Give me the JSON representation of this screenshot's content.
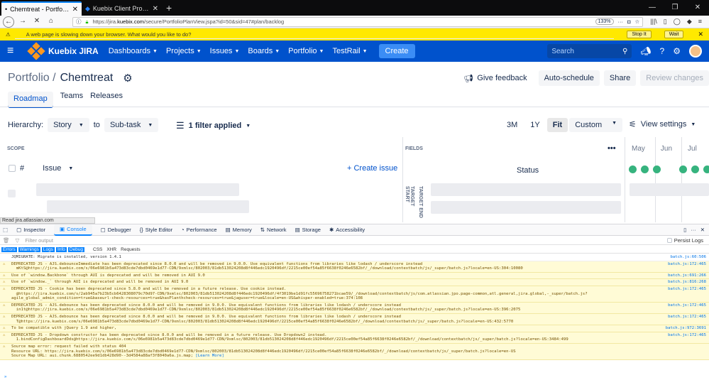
{
  "browser": {
    "tabs": [
      {
        "title": "Chemtreat - Portfolio for Jira",
        "active": true
      },
      {
        "title": "Kuebix Client Projects - Portfolio",
        "active": false
      }
    ],
    "url_prefix": "https://jira.",
    "url_domain": "kuebix.com",
    "url_path": "/secure/PortfolioPlanView.jspa?id=50&sid=47#plan/backlog",
    "zoom": "133%",
    "notification": "A web page is slowing down your browser. What would you like to do?",
    "stop_label": "Stop It",
    "wait_label": "Wait"
  },
  "jira": {
    "brand": "Kuebix JIRA",
    "nav": [
      "Dashboards",
      "Projects",
      "Issues",
      "Boards",
      "Portfolio",
      "TestRail"
    ],
    "create_label": "Create",
    "search_placeholder": "Search"
  },
  "page": {
    "breadcrumb": "Portfolio /",
    "title": "Chemtreat",
    "feedback_label": "Give feedback",
    "autoschedule_label": "Auto-schedule",
    "share_label": "Share",
    "review_label": "Review changes",
    "tabs": [
      "Roadmap",
      "Teams",
      "Releases"
    ],
    "hierarchy_label": "Hierarchy:",
    "hierarchy_from": "Story",
    "hierarchy_to_word": "to",
    "hierarchy_to": "Sub-task",
    "filter_label": "1 filter applied",
    "time_buttons": [
      "3M",
      "1Y",
      "Fit"
    ],
    "custom_label": "Custom",
    "view_settings_label": "View settings",
    "scope_header": "SCOPE",
    "fields_header": "FIELDS",
    "months": [
      "May",
      "Jun",
      "Jul"
    ],
    "hash_col": "#",
    "issue_col": "Issue",
    "create_issue_label": "+ Create issue",
    "status_col": "Status",
    "target_start": "TARGET START",
    "target_end": "TARGET END"
  },
  "statusbar": "Read jira.atlassian.com",
  "devtools": {
    "tabs": [
      "Inspector",
      "Console",
      "Debugger",
      "Style Editor",
      "Performance",
      "Memory",
      "Network",
      "Storage",
      "Accessibility"
    ],
    "filter_placeholder": "Filter output",
    "persist_label": "Persist Logs",
    "levels": [
      "Errors",
      "Warnings",
      "Logs",
      "Info",
      "Debug"
    ],
    "extra_filters": [
      "CSS",
      "XHR",
      "Requests"
    ],
    "messages": [
      {
        "type": "log",
        "text": "JQMIGRATE: Migrate is installed, version 1.4.1",
        "source": "batch.js:60:506"
      },
      {
        "type": "warn",
        "text": "DEPRECATED JS - AJS.debounceImmediate has been deprecated since 8.0.0 and will be removed in 9.0.0. Use equivalent functions from libraries like lodash / underscore instead\n  mKtS@https://jira.kuebix.com/s/06e6981b5a473d83cde7dbd0469e1d77-CDN/9xmlsc/802003/81db513024208d8f446edc1920496df/2215ce00ef54a85f6638f0246e6582bf/_/download/contextbatch/js/_super/batch.js?locale=en-US:304:10080",
        "source": "batch.js:172:465"
      },
      {
        "type": "warn",
        "text": "Use of `window.Backbone` through AUI is deprecated and will be removed in AUI 9.0",
        "source": "batch.js:691:266"
      },
      {
        "type": "warn",
        "text": "Use of `window._` through AUI is deprecated and will be removed in AUI 9.0",
        "source": "batch.js:816:268"
      },
      {
        "type": "warn",
        "text": "DEPRECATED JS - Cookie has been deprecated since 5.8.0 and will be removed in a future release. Use cookie instead.\n  @https://jira.kuebix.com/s/2ab945a7b23b5cb6428308079c70d97-CDN/9xmlsc/802003/81db513024208d8f446edc1920496df/4f3019be1d91fc55696758271bcae59/_/download/contextbatch/js/com.atlassian.jpo.page-common,atl.general,jira.global,-_super/batch.js?agile_global_admin_condition=true&baseurl-check-resources=true&hasPlanthcheck-resources=true&jaguser=true&locale=en-US&whisper-enabled=true:374:108",
        "source": "batch.js:172:465"
      },
      {
        "type": "warn",
        "text": "DEPRECATED JS - AJS.debounce has been deprecated since 8.0.0 and will be removed in 9.0.0. Use equivalent functions from libraries like lodash / underscore instead\n  in1t@https://jira.kuebix.com/s/06e6981b5a473d83cde7dbd0469e1d77-CDN/9xmlsc/802003/81db513024208d8f446edc1920496df/2215ce00ef54a85f6638f0246e6582bf/_/download/contextbatch/js/_super/batch.js?locale=en-US:396:2075",
        "source": "batch.js:172:465"
      },
      {
        "type": "warn",
        "text": "DEPRECATED JS - AJS.debounce has been deprecated since 8.0.0 and will be removed in 9.0.0. Use equivalent functions from libraries like lodash / underscore instead\n  T@https://jira.kuebix.com/s/06e6981b5a473d83cde7dbd0469e1d77-CDN/9xmlsc/802003/81db513024208d8f446edc1920496df/2215ce00ef54a85f6638f0246e6582bf/_/download/contextbatch/js/_super/batch.js?locale=en-US:432:5770",
        "source": "batch.js:172:465"
      },
      {
        "type": "warn",
        "text": "To be compatible with jQuery 1.9 and higher,",
        "source": "batch.js:972:3691"
      },
      {
        "type": "warn",
        "text": "DEPRECATED JS - Dropdown constructor has been deprecated since 8.0.0 and will be removed in a future release. Use Dropdown2 instead.\n  1.bindConfigDashboardDds@https://jira.kuebix.com/s/06e6981b5a473d83cde7dbd0469e1d77-CDN/9xmlsc/802003/81db513024208d8f446edc1920496df/2215ce00ef54a85f6638f0246e6582bf/_/download/contextbatch/js/_super/batch.js?locale=en-US:3484:499",
        "source": "batch.js:172:465"
      },
      {
        "type": "warn",
        "text": "Source map error: request failed with status 404\nResource URL: https://jira.kuebix.com/s/06e6981b5a473d83cde7dbd0469e1d77-CDN/9xmlsc/802003/81db513024208d8f446edc1920496df/2215ce00ef54a85f6638f0246e6582bf/_/download/contextbatch/js/_super/batch.js?locale=en-US\nSource Map URL: aui.chunk.6880542ee9d1db428d90--3d4584a88af3f8040a6a.js.map;",
        "source": "",
        "link": "[Learn More]"
      }
    ],
    "prompt": "»"
  }
}
